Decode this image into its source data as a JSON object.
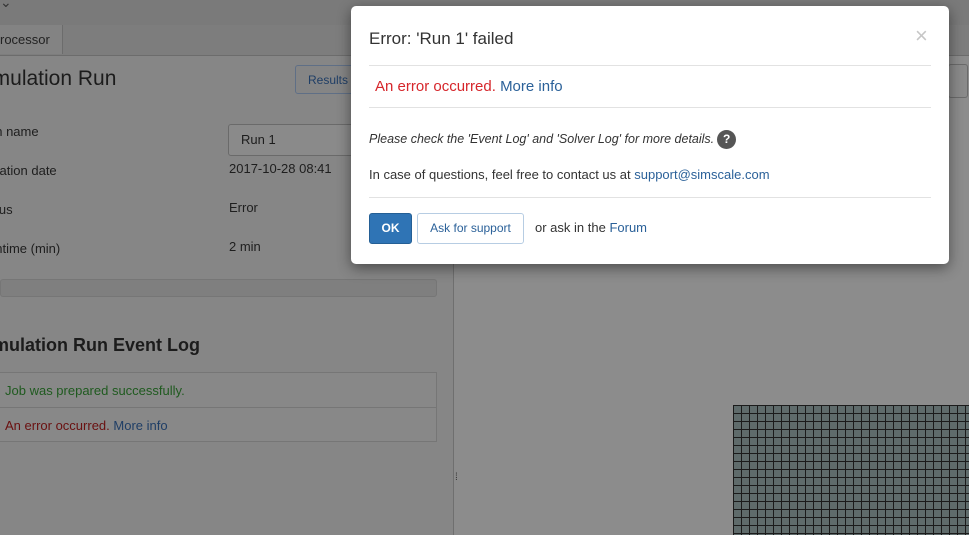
{
  "background": {
    "tab_label": "rocessor",
    "panel_title": "imulation Run",
    "results_button_label": "Results",
    "fields": [
      {
        "label": "un name",
        "value": "Run 1"
      },
      {
        "label": "reation date",
        "value": "2017-10-28 08:41"
      },
      {
        "label": "atus",
        "value": "Error"
      },
      {
        "label": "untime (min)",
        "value": "2 min"
      }
    ],
    "event_log_title": "imulation Run Event Log",
    "event_log": [
      {
        "text": "Job was prepared successfully."
      },
      {
        "text": "An error occurred.",
        "link": "More info"
      }
    ]
  },
  "modal": {
    "title": "Error: 'Run 1' failed",
    "error_text": "An error occurred.",
    "more_info_link": "More info",
    "check_text": "Please check the 'Event Log' and 'Solver Log' for more details.",
    "help_icon_glyph": "?",
    "contact_text": "In case of questions, feel free to contact us at",
    "support_email": "support@simscale.com",
    "ok_label": "OK",
    "ask_support_label": "Ask for support",
    "forum_prefix": "or ask in the",
    "forum_link": "Forum",
    "close_glyph": "×"
  },
  "colors": {
    "error": "#d6262b",
    "link": "#2b6199",
    "primary_button": "#2f74b5",
    "success_text": "#1f5a1f"
  },
  "icons": [
    "close-icon",
    "help-icon",
    "chevron-icon"
  ]
}
